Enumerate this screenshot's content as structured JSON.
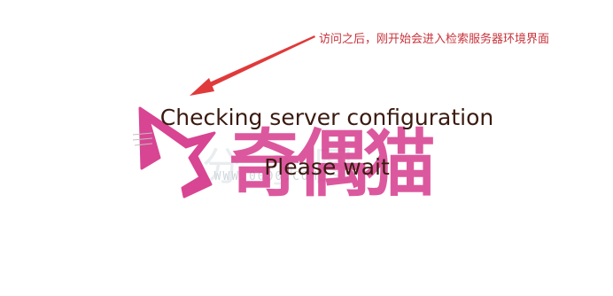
{
  "annotation": {
    "text": "访问之后，刚开始会进入检索服务器环境界面",
    "color": "#c8323a"
  },
  "status": {
    "heading": "Checking server configuration",
    "subheading": "Please wait"
  },
  "watermark": {
    "brand": "奇偶猫",
    "url": "Y.WWW.0000.COM",
    "color": "#d63c8e"
  }
}
